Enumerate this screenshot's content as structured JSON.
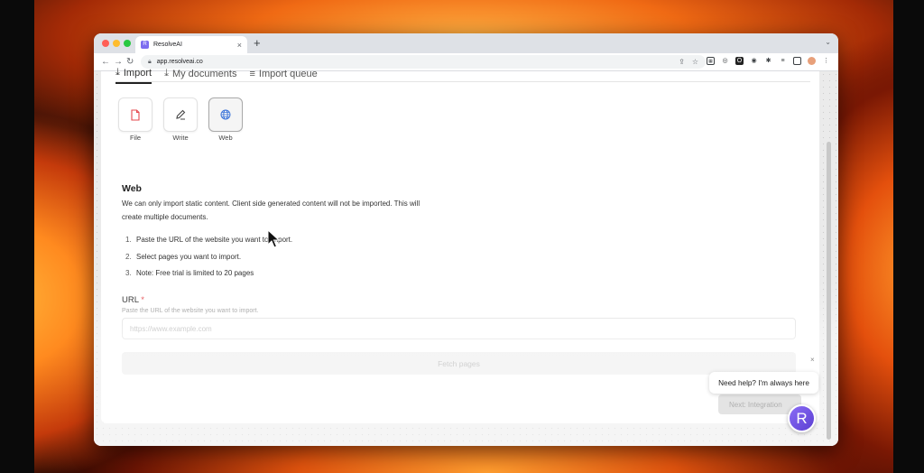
{
  "browser": {
    "tab_title": "ResolveAI",
    "tab_favicon_letter": "R",
    "url": "app.resolveai.co"
  },
  "nav": {
    "tabs": [
      {
        "label": "Import",
        "active": true
      },
      {
        "label": "My documents",
        "active": false
      },
      {
        "label": "Import queue",
        "active": false
      }
    ]
  },
  "sources": [
    {
      "label": "File",
      "icon": "file-icon",
      "selected": false
    },
    {
      "label": "Write",
      "icon": "pencil-icon",
      "selected": false
    },
    {
      "label": "Web",
      "icon": "globe-icon",
      "selected": true
    }
  ],
  "web_panel": {
    "title": "Web",
    "description": "We can only import static content. Client side generated content will not be imported. This will create multiple documents.",
    "steps": [
      {
        "num": "1.",
        "text": "Paste the URL of the website you want to import."
      },
      {
        "num": "2.",
        "text": "Select pages you want to import."
      },
      {
        "num": "3.",
        "text": "Note: Free trial is limited to 20 pages"
      }
    ],
    "url_label": "URL",
    "url_required_marker": "*",
    "url_help": "Paste the URL of the website you want to import.",
    "url_placeholder": "https://www.example.com",
    "url_value": "",
    "fetch_button": "Fetch pages"
  },
  "footer": {
    "next_button": "Next: Integration"
  },
  "chat_widget": {
    "bubble_text": "Need help? I'm always here",
    "launcher_letter": "R",
    "close_glyph": "×"
  },
  "colors": {
    "accent_purple": "#7c5cf0",
    "required_red": "#e5484d",
    "file_icon_red": "#e5484d",
    "globe_icon_blue": "#3b74d9"
  }
}
